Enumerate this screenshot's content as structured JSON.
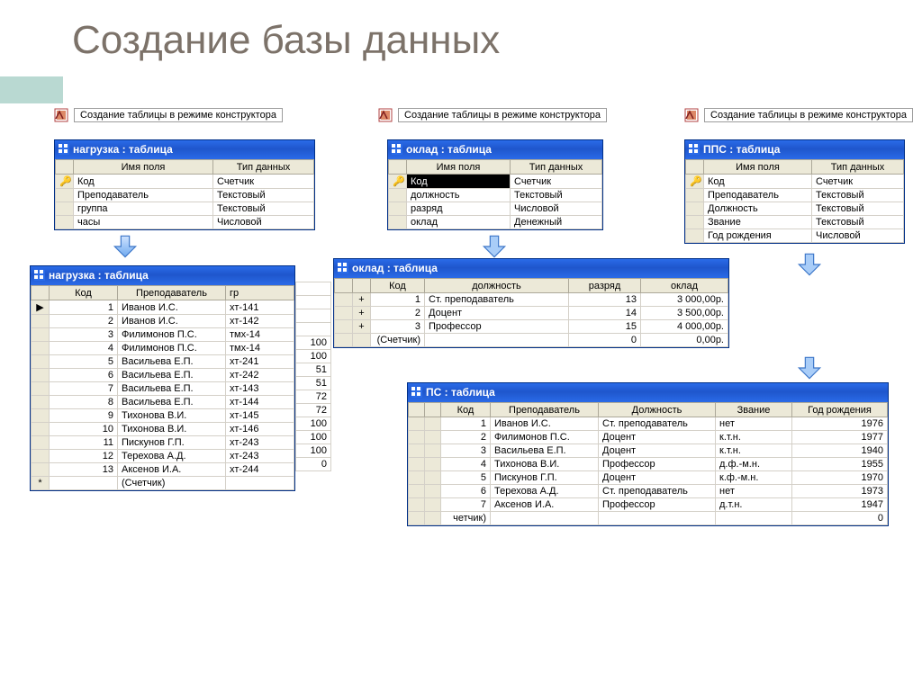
{
  "title": "Создание базы данных",
  "link_pill": "Создание таблицы в режиме конструктора",
  "design_headers": {
    "field": "Имя поля",
    "type": "Тип данных"
  },
  "design1": {
    "title": "нагрузка : таблица",
    "rows": [
      {
        "k": "🔑",
        "f": "Код",
        "t": "Счетчик"
      },
      {
        "k": "",
        "f": "Преподаватель",
        "t": "Текстовый"
      },
      {
        "k": "",
        "f": "группа",
        "t": "Текстовый"
      },
      {
        "k": "",
        "f": "часы",
        "t": "Числовой"
      }
    ]
  },
  "design2": {
    "title": "оклад : таблица",
    "rows": [
      {
        "k": "🔑",
        "f": "Код",
        "t": "Счетчик",
        "hl": true
      },
      {
        "k": "",
        "f": "должность",
        "t": "Текстовый"
      },
      {
        "k": "",
        "f": "разряд",
        "t": "Числовой"
      },
      {
        "k": "",
        "f": "оклад",
        "t": "Денежный"
      }
    ]
  },
  "design3": {
    "title": "ППС : таблица",
    "rows": [
      {
        "k": "🔑",
        "f": "Код",
        "t": "Счетчик"
      },
      {
        "k": "",
        "f": "Преподаватель",
        "t": "Текстовый"
      },
      {
        "k": "",
        "f": "Должность",
        "t": "Текстовый"
      },
      {
        "k": "",
        "f": "Звание",
        "t": "Текстовый"
      },
      {
        "k": "",
        "f": "Год рождения",
        "t": "Числовой"
      }
    ]
  },
  "data1": {
    "title": "нагрузка : таблица",
    "cols": [
      "Код",
      "Преподаватель",
      "гр"
    ],
    "rows": [
      [
        "▶",
        "1",
        "Иванов И.С.",
        "хт-141"
      ],
      [
        "",
        "2",
        "Иванов И.С.",
        "хт-142"
      ],
      [
        "",
        "3",
        "Филимонов П.С.",
        "тмх-14"
      ],
      [
        "",
        "4",
        "Филимонов П.С.",
        "тмх-14"
      ],
      [
        "",
        "5",
        "Васильева Е.П.",
        "хт-241"
      ],
      [
        "",
        "6",
        "Васильева Е.П.",
        "хт-242"
      ],
      [
        "",
        "7",
        "Васильева Е.П.",
        "хт-143"
      ],
      [
        "",
        "8",
        "Васильева Е.П.",
        "хт-144"
      ],
      [
        "",
        "9",
        "Тихонова В.И.",
        "хт-145"
      ],
      [
        "",
        "10",
        "Тихонова В.И.",
        "хт-146"
      ],
      [
        "",
        "11",
        "Пискунов Г.П.",
        "хт-243"
      ],
      [
        "",
        "12",
        "Терехова А.Д.",
        "хт-243"
      ],
      [
        "",
        "13",
        "Аксенов И.А.",
        "хт-244"
      ],
      [
        "*",
        "",
        "(Счетчик)",
        ""
      ]
    ],
    "tail": [
      "",
      "",
      "",
      "",
      "100",
      "100",
      "51",
      "51",
      "72",
      "72",
      "100",
      "100",
      "100",
      "0"
    ]
  },
  "data2": {
    "title": "оклад : таблица",
    "cols": [
      "Код",
      "должность",
      "разряд",
      "оклад"
    ],
    "rows": [
      [
        "+",
        "1",
        "Ст. преподаватель",
        "13",
        "3 000,00р."
      ],
      [
        "+",
        "2",
        "Доцент",
        "14",
        "3 500,00р."
      ],
      [
        "+",
        "3",
        "Профессор",
        "15",
        "4 000,00р."
      ],
      [
        "",
        "(Счетчик)",
        "",
        "0",
        "0,00р."
      ]
    ]
  },
  "data3": {
    "title": "ПС : таблица",
    "cols": [
      "Код",
      "Преподаватель",
      "Должность",
      "Звание",
      "Год рождения"
    ],
    "rows": [
      [
        "",
        "1",
        "Иванов И.С.",
        "Ст. преподаватель",
        "нет",
        "1976"
      ],
      [
        "",
        "2",
        "Филимонов П.С.",
        "Доцент",
        "к.т.н.",
        "1977"
      ],
      [
        "",
        "3",
        "Васильева Е.П.",
        "Доцент",
        "к.т.н.",
        "1940"
      ],
      [
        "",
        "4",
        "Тихонова В.И.",
        "Профессор",
        "д.ф.-м.н.",
        "1955"
      ],
      [
        "",
        "5",
        "Пискунов Г.П.",
        "Доцент",
        "к.ф.-м.н.",
        "1970"
      ],
      [
        "",
        "6",
        "Терехова А.Д.",
        "Ст. преподаватель",
        "нет",
        "1973"
      ],
      [
        "",
        "7",
        "Аксенов И.А.",
        "Профессор",
        "д.т.н.",
        "1947"
      ],
      [
        "",
        "четчик)",
        "",
        "",
        "",
        "0"
      ]
    ]
  }
}
